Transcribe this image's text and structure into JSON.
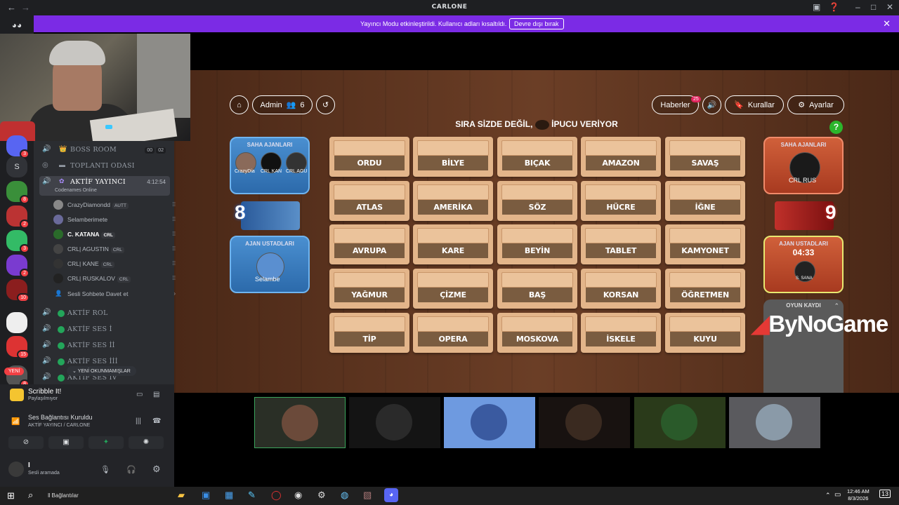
{
  "window": {
    "title": "CARLONE",
    "back": "←",
    "forward": "→"
  },
  "banner": {
    "message": "Yayıncı Modu etkinleştirildi. Kullanıcı adları kısaltıldı.",
    "button": "Devre dışı bırak",
    "close": "✕"
  },
  "rail": {
    "server_letter": "S",
    "badges": [
      "3",
      "8",
      "2",
      "3",
      "2",
      "10",
      "15",
      "8"
    ]
  },
  "channels": [
    {
      "name": "BOSS ROOM",
      "counts": [
        "00",
        "02"
      ]
    },
    {
      "name": "TOPLANTI ODASI"
    },
    {
      "name": "AKTİF YAYINCI",
      "time": "4:12:54",
      "subtitle": "Codenames Online"
    }
  ],
  "voice_users": [
    {
      "name": "CrazyDiamondd",
      "tag": "AUTT"
    },
    {
      "name": "Selamberimete",
      "tag": ""
    },
    {
      "name": "C. KATANA",
      "tag": "CRL"
    },
    {
      "name": "CRL| AGUSTIN",
      "tag": "CRL"
    },
    {
      "name": "CRL| KANE",
      "tag": "CRL"
    },
    {
      "name": "CRL| RUSKALOV",
      "tag": "CRL"
    }
  ],
  "invite": "Sesli Sohbete Davet et",
  "channels2": [
    "AKTİF ROL",
    "AKTİF SES İ",
    "AKTİF SES İİ",
    "AKTİF SES İİİ",
    "AKTİF SES İV"
  ],
  "unread_label": "YENİ OKUNMAMIŞLAR",
  "new_label": "YENİ",
  "activity": {
    "game": "Scribble It!",
    "game_sub": "Paylaşılmıyor",
    "voice_status": "Ses Bağlantısı Kuruldu",
    "voice_channel": "AKTİF YAYINCI / CARLONE",
    "user_name": "I",
    "user_status": "Sesli aramada"
  },
  "game": {
    "admin": "Admin",
    "players": "6",
    "news": "Haberler",
    "news_badge": "25",
    "rules": "Kurallar",
    "settings": "Ayarlar",
    "turn_left": "SIRA SİZDE DEĞİL,",
    "turn_right": "İPUCU VERİYOR",
    "help": "?",
    "blue": {
      "field": "SAHA AJANLARI",
      "players": [
        "CrazyDia",
        "CRL KAN",
        "CRL AGU"
      ],
      "score": "8",
      "master": "AJAN USTADLARI",
      "master_player": "Selambe"
    },
    "red": {
      "field": "SAHA AJANLARI",
      "players": [
        "CRL RUS"
      ],
      "score": "9",
      "master": "AJAN USTADLARI",
      "timer": "04:33",
      "master_player": "S. SANA"
    },
    "log": "OYUN KAYDI",
    "watermark": "ByNoGame",
    "words": [
      [
        "ORDU",
        "BİLYE",
        "BIÇAK",
        "AMAZON",
        "SAVAŞ"
      ],
      [
        "ATLAS",
        "AMERİKA",
        "SÖZ",
        "HÜCRE",
        "İĞNE"
      ],
      [
        "AVRUPA",
        "KARE",
        "BEYİN",
        "TABLET",
        "KAMYONET"
      ],
      [
        "YAĞMUR",
        "ÇİZME",
        "BAŞ",
        "KORSAN",
        "ÖĞRETMEN"
      ],
      [
        "TİP",
        "OPERA",
        "MOSKOVA",
        "İSKELE",
        "KUYU"
      ]
    ]
  },
  "taskbar": {
    "connections": "Bağlantılar",
    "time": "12:46 AM",
    "date": "8/3/2026",
    "notif": "13"
  }
}
